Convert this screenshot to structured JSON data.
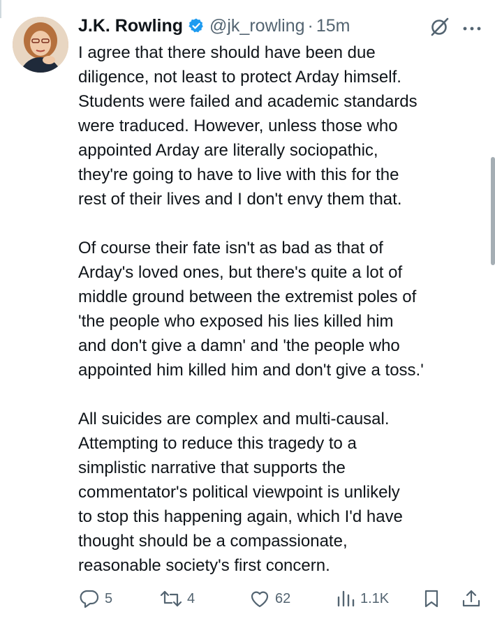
{
  "author": {
    "display_name": "J.K. Rowling",
    "handle": "@jk_rowling",
    "separator": "·",
    "time": "15m",
    "verified": true,
    "verified_color": "#1d9bf0"
  },
  "tweet": {
    "paragraphs": [
      "I agree that there should have been due\ndiligence, not least to protect Arday himself.\nStudents were failed and academic standards\nwere traduced. However, unless those who\nappointed Arday are literally sociopathic,\nthey're going to have to live with this for the\nrest of their lives and I don't envy them that.",
      "Of course their fate isn't as bad as that of\nArday's loved ones, but there's quite a lot of\nmiddle ground between the extremist poles of\n'the people who exposed his lies killed him\nand don't give a damn' and 'the people who\nappointed him killed him and don't give a toss.'",
      "All suicides are complex and multi-causal.\nAttempting to reduce this tragedy to a\nsimplistic narrative that supports the\ncommentator's political viewpoint is unlikely\nto stop this happening again, which I'd have\nthought should be a compassionate,\nreasonable society's first concern."
    ]
  },
  "actions": {
    "replies": "5",
    "reposts": "4",
    "likes": "62",
    "views": "1.1K"
  },
  "icons": {
    "reply": "reply-icon",
    "repost": "repost-icon",
    "like": "heart-icon",
    "views": "views-icon",
    "bookmark": "bookmark-icon",
    "share": "share-icon",
    "grok": "grok-icon",
    "more": "more-icon",
    "verified": "verified-badge-icon"
  },
  "colors": {
    "text": "#0f1419",
    "secondary": "#536471"
  }
}
